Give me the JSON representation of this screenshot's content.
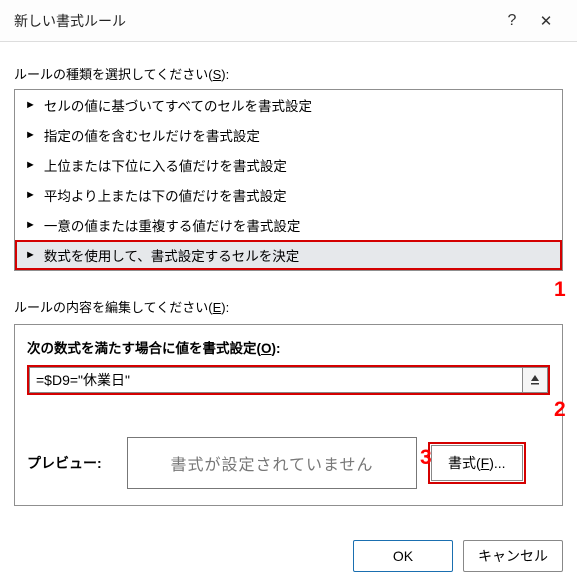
{
  "titlebar": {
    "title": "新しい書式ルール",
    "help": "?",
    "close": "✕"
  },
  "select_label_pre": "ルールの種類を選択してください(",
  "select_label_u": "S",
  "select_label_post": "):",
  "rule_types": {
    "r0": "セルの値に基づいてすべてのセルを書式設定",
    "r1": "指定の値を含むセルだけを書式設定",
    "r2": "上位または下位に入る値だけを書式設定",
    "r3": "平均より上または下の値だけを書式設定",
    "r4": "一意の値または重複する値だけを書式設定",
    "r5": "数式を使用して、書式設定するセルを決定"
  },
  "edit_label_pre": "ルールの内容を編集してください(",
  "edit_label_u": "E",
  "edit_label_post": "):",
  "formula_label_pre": "次の数式を満たす場合に値を書式設定(",
  "formula_label_u": "O",
  "formula_label_post": "):",
  "formula_value": "=$D9=\"休業日\"",
  "preview_label": "プレビュー:",
  "preview_text": "書式が設定されていません",
  "format_btn_pre": "書式(",
  "format_btn_u": "F",
  "format_btn_post": ")...",
  "buttons": {
    "ok": "OK",
    "cancel": "キャンセル"
  },
  "annotations": {
    "a1": "1",
    "a2": "2",
    "a3": "3"
  }
}
